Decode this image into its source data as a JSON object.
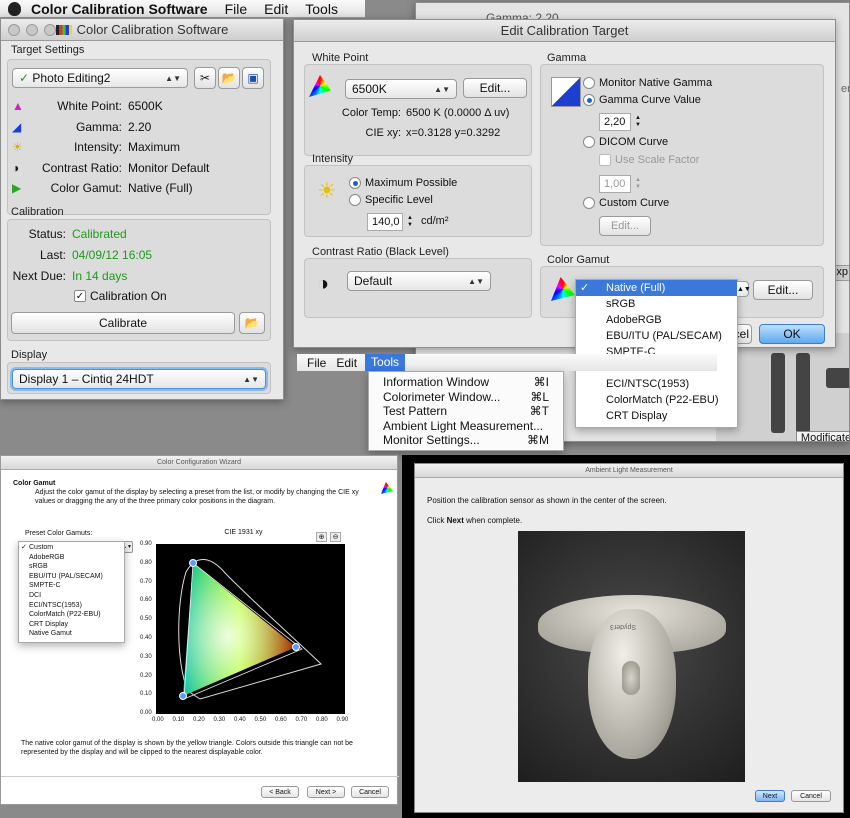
{
  "menubar": {
    "app": "Color Calibration Software",
    "items": [
      "File",
      "Edit",
      "Tools"
    ]
  },
  "main_window": {
    "title": "Color Calibration Software",
    "target_settings": {
      "section": "Target Settings",
      "preset": "Photo Editing2",
      "rows": [
        {
          "label": "White Point:",
          "value": "6500K"
        },
        {
          "label": "Gamma:",
          "value": "2.20"
        },
        {
          "label": "Intensity:",
          "value": "Maximum"
        },
        {
          "label": "Contrast Ratio:",
          "value": "Monitor Default"
        },
        {
          "label": "Color Gamut:",
          "value": "Native (Full)"
        }
      ]
    },
    "calibration": {
      "section": "Calibration",
      "status_label": "Status:",
      "status": "Calibrated",
      "last_label": "Last:",
      "last": "04/09/12 16:05",
      "next_label": "Next Due:",
      "next": "In 14 days",
      "checkbox": "Calibration On",
      "button": "Calibrate"
    },
    "display": {
      "section": "Display",
      "value": "Display 1 – Cintiq 24HDT"
    }
  },
  "bg_window": {
    "gamma_text": "Gamma: 2.20",
    "right_text": "er",
    "exp_text": "Exp",
    "modificate": "Modificate"
  },
  "edit_dialog": {
    "title": "Edit Calibration Target",
    "white_point": {
      "section": "White Point",
      "value": "6500K",
      "edit": "Edit...",
      "color_temp_label": "Color Temp:",
      "color_temp": "6500 K (0.0000 Δ uv)",
      "cie_label": "CIE xy:",
      "cie": "x=0.3128 y=0.3292"
    },
    "intensity": {
      "section": "Intensity",
      "opt1": "Maximum Possible",
      "opt2": "Specific Level",
      "level": "140,0",
      "unit": "cd/m²"
    },
    "contrast": {
      "section": "Contrast Ratio (Black Level)",
      "value": "Default"
    },
    "gamma": {
      "section": "Gamma",
      "opt1": "Monitor Native Gamma",
      "opt2": "Gamma Curve Value",
      "curve_value": "2,20",
      "opt3": "DICOM Curve",
      "scale_factor": "Use Scale Factor",
      "scale_value": "1,00",
      "opt4": "Custom Curve",
      "edit": "Edit..."
    },
    "gamut": {
      "section": "Color Gamut",
      "edit": "Edit..."
    },
    "cancel_fragment": "cel",
    "ok": "OK"
  },
  "gamut_dropdown": [
    "Native (Full)",
    "sRGB",
    "AdobeRGB",
    "EBU/ITU (PAL/SECAM)",
    "SMPTE-C",
    "DCI",
    "ECI/NTSC(1953)",
    "ColorMatch (P22-EBU)",
    "CRT Display"
  ],
  "tools_menu": {
    "bar": [
      "File",
      "Edit",
      "Tools"
    ],
    "items": [
      {
        "label": "Information Window",
        "key": "⌘I"
      },
      {
        "label": "Colorimeter Window...",
        "key": "⌘L"
      },
      {
        "label": "Test Pattern",
        "key": "⌘T"
      },
      {
        "label": "Ambient Light Measurement...",
        "key": ""
      },
      {
        "label": "Monitor Settings...",
        "key": "⌘M"
      }
    ]
  },
  "wizard": {
    "title": "Color Configuration Wizard",
    "heading": "Color Gamut",
    "desc": "Adjust the color gamut of the display by selecting a preset from the list, or modify by changing the CIE xy values or dragging the any of the three primary color positions in the diagram.",
    "preset_label": "Preset Color Gamuts:",
    "presets": [
      "Custom",
      "AdobeRGB",
      "sRGB",
      "EBU/ITU (PAL/SECAM)",
      "SMPTE-C",
      "DCI",
      "ECI/NTSC(1953)",
      "ColorMatch (P22-EBU)",
      "CRT Display",
      "Native Gamut"
    ],
    "chart_title": "CIE 1931 xy",
    "y_ticks": [
      "0.90",
      "0.80",
      "0.70",
      "0.60",
      "0.50",
      "0.40",
      "0.30",
      "0.20",
      "0.10",
      "0.00"
    ],
    "x_ticks": [
      "0.00",
      "0.10",
      "0.20",
      "0.30",
      "0.40",
      "0.50",
      "0.60",
      "0.70",
      "0.80",
      "0.90"
    ],
    "note": "The native color gamut of the display is shown by the yellow triangle. Colors outside this triangle can not be represented by the display and will be clipped to the nearest displayable color.",
    "back": "< Back",
    "next": "Next >",
    "cancel": "Cancel"
  },
  "ambient": {
    "title": "Ambient Light Measurement",
    "line1": "Position the calibration sensor as shown in the center of the screen.",
    "line2_pre": "Click ",
    "line2_bold": "Next",
    "line2_post": " when complete.",
    "brand": "Spyder3",
    "next": "Next",
    "cancel": "Cancel"
  }
}
